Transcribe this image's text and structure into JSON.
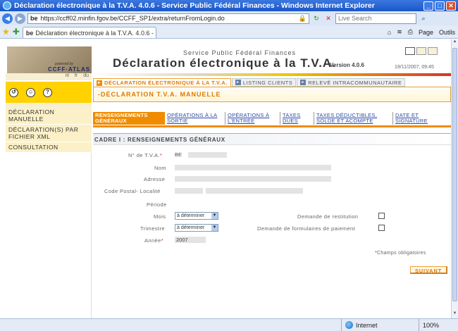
{
  "browser": {
    "window_title": "Déclaration électronique à la T.V.A. 4.0.6 - Service Public Fédéral Finances - Windows Internet Explorer",
    "url_prefix": "be",
    "url": "https://ccff02.minfin.fgov.be/CCFF_SP1/extra/returnFromLogin.do",
    "search_placeholder": "Live Search",
    "tab_label": "Déclaration électronique à la T.V.A. 4.0.6 - Service Pu...",
    "page_menu": "Page",
    "tools_menu": "Outils",
    "status_zone": "Internet",
    "zoom": "100%"
  },
  "header": {
    "powered_by": "powered by",
    "brand": "CCFF·ATLAS",
    "service": "Service Public Fédéral Finances",
    "title": "Déclaration électronique à la T.V.A.",
    "version": "Version 4.0.6",
    "datetime": "19/11/2007, 09:45"
  },
  "sidebar": {
    "languages": [
      "nl",
      "fr",
      "du"
    ],
    "items": [
      {
        "label": "DÉCLARATION MANUELLE"
      },
      {
        "label": "DÉCLARATION(S) PAR FICHIER XML"
      },
      {
        "label": "CONSULTATION"
      }
    ]
  },
  "top_tabs": [
    {
      "label": "DÉCLARATION ÉLECTRONIQUE À LA T.V.A."
    },
    {
      "label": "LISTING CLIENTS"
    },
    {
      "label": "RELEVÉ INTRACOMMUNAUTAIRE"
    }
  ],
  "subtitle": "-DÉCLARATION T.V.A. MANUELLE",
  "steps": [
    {
      "label": "RENSEIGNEMENTS GÉNÉRAUX"
    },
    {
      "label": "OPÉRATIONS À LA SORTIE"
    },
    {
      "label": "OPÉRATIONS À L'ENTRÉE"
    },
    {
      "label": "TAXES DUES"
    },
    {
      "label": "TAXES DÉDUCTIBLES, SOLDE ET ACOMPTE"
    },
    {
      "label": "DATE ET SIGNATURE"
    }
  ],
  "section_title": "CADRE I : RENSEIGNEMENTS GÉNÉRAUX",
  "form": {
    "vat_label": "N° de T.V.A.",
    "vat_prefix": "BE",
    "name_label": "Nom",
    "address_label": "Adresse",
    "postal_label": "Code Postal- Localité",
    "period_label": "Période",
    "month_label": "Mois",
    "month_value": "à déterminer",
    "quarter_label": "Trimestre",
    "quarter_value": "à déterminer",
    "year_label": "Année",
    "year_value": "2007",
    "restitution_label": "Demande de restitution",
    "payment_forms_label": "Demande de formulaires de paiement",
    "required_note": "Champs obligatoires",
    "required_marker": "*"
  },
  "next_button": "SUIVANT"
}
